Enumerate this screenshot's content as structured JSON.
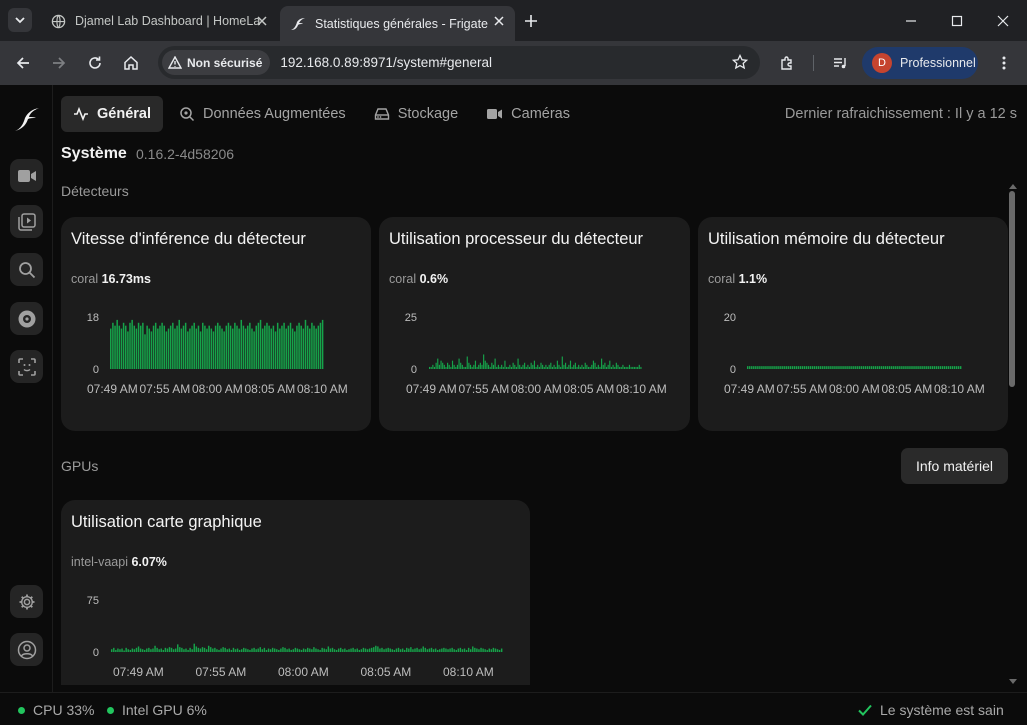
{
  "browser": {
    "tabs": [
      {
        "title": "Djamel Lab Dashboard | HomeLab",
        "active": false,
        "icon": "globe-icon"
      },
      {
        "title": "Statistiques générales - Frigate",
        "active": true,
        "icon": "frigate-bird-icon"
      }
    ],
    "security_label": "Non sécurisé",
    "url": "192.168.0.89:8971/system#general",
    "profile_initial": "D",
    "profile_label": "Professionnel"
  },
  "nav": {
    "tabs": [
      "Général",
      "Données Augmentées",
      "Stockage",
      "Caméras"
    ],
    "active_tab": "Général",
    "last_refresh": "Dernier rafraichissement : Il y a 12 s"
  },
  "system": {
    "title": "Système",
    "version": "0.16.2-4d58206"
  },
  "sections": {
    "detectors": "Détecteurs",
    "gpus": "GPUs"
  },
  "hardware_button": "Info matériel",
  "cards": {
    "inference": {
      "title": "Vitesse d'inférence du détecteur",
      "label": "coral",
      "value": "16.73ms"
    },
    "cpu": {
      "title": "Utilisation processeur du détecteur",
      "label": "coral",
      "value": "0.6%"
    },
    "memory": {
      "title": "Utilisation mémoire du détecteur",
      "label": "coral",
      "value": "1.1%"
    },
    "gpu": {
      "title": "Utilisation carte graphique",
      "label": "intel-vaapi",
      "value": "6.07%"
    }
  },
  "footer": {
    "cpu": "CPU 33%",
    "gpu": "Intel GPU 6%",
    "status": "Le système est sain"
  },
  "colors": {
    "bar": "#16a34a",
    "accent_status": "#22c55e"
  },
  "chart_data": [
    {
      "type": "bar",
      "name": "Vitesse d'inférence du détecteur",
      "x_tick_labels": [
        "07:49 AM",
        "07:55 AM",
        "08:00 AM",
        "08:05 AM",
        "08:10 AM"
      ],
      "y_ticks": [
        0,
        18
      ],
      "ylim": [
        0,
        18
      ],
      "grid": false,
      "values": [
        14,
        16,
        15,
        17,
        15,
        14,
        16,
        15,
        13,
        16,
        17,
        15,
        14,
        16,
        15,
        16,
        12,
        15,
        14,
        13,
        15,
        16,
        14,
        15,
        16,
        15,
        13,
        14,
        15,
        16,
        14,
        15,
        17,
        14,
        15,
        16,
        13,
        14,
        15,
        16,
        14,
        15,
        13,
        16,
        15,
        14,
        15,
        14,
        13,
        15,
        16,
        15,
        14,
        13,
        15,
        16,
        15,
        14,
        16,
        15,
        14,
        17,
        15,
        14,
        15,
        16,
        14,
        13,
        15,
        16,
        17,
        14,
        15,
        16,
        15,
        14,
        15,
        13,
        16,
        14,
        15,
        16,
        14,
        15,
        16,
        14,
        13,
        15,
        16,
        15,
        14,
        17,
        15,
        14,
        16,
        15,
        14,
        15,
        16,
        17
      ]
    },
    {
      "type": "bar",
      "name": "Utilisation processeur du détecteur",
      "x_tick_labels": [
        "07:49 AM",
        "07:55 AM",
        "08:00 AM",
        "08:05 AM",
        "08:10 AM"
      ],
      "y_ticks": [
        0,
        25
      ],
      "ylim": [
        0,
        25
      ],
      "grid": false,
      "values": [
        1,
        1,
        2,
        1,
        3,
        5,
        2,
        4,
        3,
        2,
        1,
        3,
        2,
        1,
        4,
        2,
        1,
        2,
        5,
        3,
        2,
        1,
        1,
        6,
        3,
        2,
        1,
        2,
        4,
        1,
        2,
        3,
        2,
        7,
        4,
        3,
        2,
        1,
        3,
        2,
        5,
        1,
        2,
        1,
        2,
        1,
        4,
        1,
        1,
        2,
        1,
        3,
        2,
        1,
        5,
        2,
        1,
        2,
        3,
        1,
        2,
        1,
        3,
        2,
        4,
        1,
        2,
        1,
        3,
        2,
        1,
        2,
        1,
        2,
        3,
        1,
        2,
        1,
        4,
        2,
        1,
        6,
        2,
        3,
        1,
        2,
        4,
        1,
        2,
        3,
        1,
        2,
        1,
        2,
        1,
        3,
        2,
        1,
        1,
        2,
        4,
        3,
        1,
        2,
        1,
        5,
        2,
        3,
        1,
        2,
        4,
        1,
        2,
        1,
        3,
        2,
        1,
        1,
        2,
        1,
        1,
        1,
        2,
        1,
        1,
        1,
        1,
        1,
        2,
        1
      ]
    },
    {
      "type": "bar",
      "name": "Utilisation mémoire du détecteur",
      "x_tick_labels": [
        "07:49 AM",
        "07:55 AM",
        "08:00 AM",
        "08:05 AM",
        "08:10 AM"
      ],
      "y_ticks": [
        0,
        20
      ],
      "ylim": [
        0,
        20
      ],
      "grid": false,
      "values": [
        1.1,
        1.1,
        1.1,
        1.1,
        1.1,
        1.1,
        1.1,
        1.1,
        1.1,
        1.1,
        1.1,
        1.1,
        1.1,
        1.1,
        1.1,
        1.1,
        1.1,
        1.1,
        1.1,
        1.1,
        1.1,
        1.1,
        1.1,
        1.1,
        1.1,
        1.1,
        1.1,
        1.1,
        1.1,
        1.1,
        1.1,
        1.1,
        1.1,
        1.1,
        1.1,
        1.1,
        1.1,
        1.1,
        1.1,
        1.1,
        1.1,
        1.1,
        1.1,
        1.1,
        1.1,
        1.1,
        1.1,
        1.1,
        1.1,
        1.1,
        1.1,
        1.1,
        1.1,
        1.1,
        1.1,
        1.1,
        1.1,
        1.1,
        1.1,
        1.1,
        1.1,
        1.1,
        1.1,
        1.1,
        1.1,
        1.1,
        1.1,
        1.1,
        1.1,
        1.1,
        1.1,
        1.1,
        1.1,
        1.1,
        1.1,
        1.1,
        1.1,
        1.1,
        1.1,
        1.1,
        1.1,
        1.1,
        1.1,
        1.1,
        1.1,
        1.1,
        1.1,
        1.1,
        1.1,
        1.1,
        1.1,
        1.1,
        1.1,
        1.1,
        1.1,
        1.1,
        1.1,
        1.1,
        1.1,
        1.1,
        1.1,
        1.1,
        1.1,
        1.1,
        1.1,
        1.1
      ]
    },
    {
      "type": "bar",
      "name": "Utilisation carte graphique",
      "x_tick_labels": [
        "07:49 AM",
        "07:55 AM",
        "08:00 AM",
        "08:05 AM",
        "08:10 AM"
      ],
      "y_ticks": [
        0,
        75
      ],
      "ylim": [
        0,
        75
      ],
      "grid": false,
      "values": [
        4,
        6,
        3,
        5,
        4,
        5,
        2,
        6,
        4,
        3,
        5,
        4,
        6,
        8,
        5,
        4,
        3,
        5,
        6,
        4,
        5,
        9,
        6,
        4,
        5,
        3,
        6,
        5,
        7,
        6,
        4,
        5,
        11,
        7,
        6,
        4,
        5,
        3,
        6,
        4,
        12,
        8,
        6,
        5,
        7,
        6,
        4,
        9,
        7,
        5,
        6,
        4,
        3,
        5,
        7,
        6,
        4,
        5,
        3,
        6,
        4,
        5,
        3,
        4,
        6,
        5,
        4,
        3,
        5,
        6,
        4,
        5,
        7,
        4,
        6,
        3,
        5,
        4,
        6,
        5,
        4,
        3,
        5,
        7,
        6,
        4,
        5,
        3,
        4,
        6,
        5,
        4,
        3,
        5,
        4,
        6,
        5,
        4,
        7,
        5,
        4,
        3,
        6,
        5,
        4,
        8,
        5,
        6,
        4,
        3,
        5,
        6,
        4,
        5,
        3,
        4,
        5,
        6,
        4,
        5,
        3,
        4,
        6,
        5,
        4,
        5,
        6,
        7,
        9,
        8,
        5,
        6,
        4,
        5,
        6,
        5,
        4,
        3,
        5,
        6,
        4,
        5,
        3,
        6,
        5,
        7,
        4,
        5,
        6,
        4,
        5,
        8,
        6,
        4,
        5,
        6,
        4,
        5,
        3,
        4,
        5,
        6,
        5,
        4,
        5,
        6,
        4,
        3,
        5,
        6,
        4,
        5,
        3,
        6,
        4,
        8,
        6,
        5,
        4,
        6,
        5,
        4,
        3,
        5,
        4,
        6,
        5,
        4,
        3,
        5
      ]
    }
  ]
}
